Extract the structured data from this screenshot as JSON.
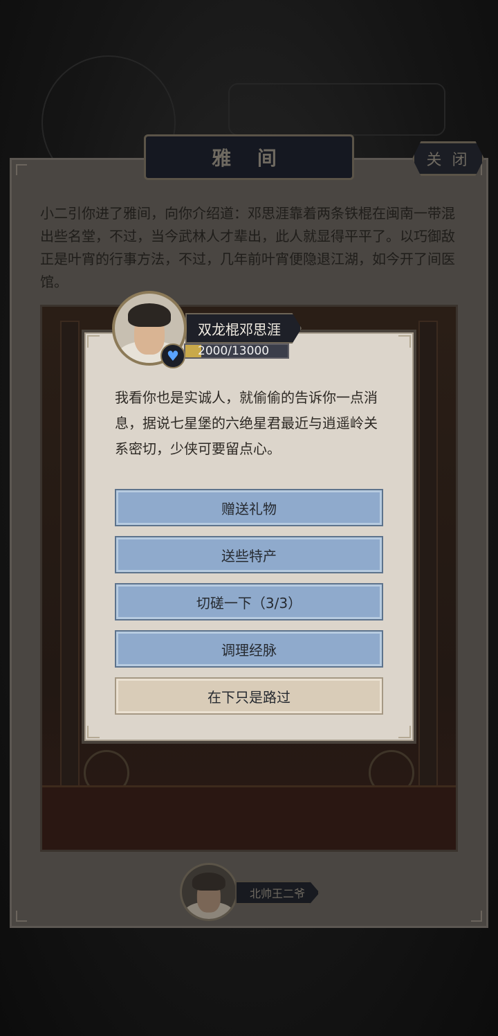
{
  "background": {
    "banner_text": "",
    "nav_items": []
  },
  "panel": {
    "title": "雅 间",
    "close_label": "关 闭",
    "intro": "小二引你进了雅间，向你介绍道：邓思涯靠着两条铁棍在闽南一带混出些名堂，不过，当今武林人才辈出，此人就显得平平了。以巧御敌正是叶宵的行事方法，不过，几年前叶宵便隐退江湖，如今开了间医馆。"
  },
  "npc": {
    "name": "双龙棍邓思涯",
    "affinity_text": "2000/13000",
    "affinity_fraction": 0.154,
    "heart_icon": "heart-icon"
  },
  "dialog": {
    "text": "我看你也是实诚人，就偷偷的告诉你一点消息，据说七星堡的六绝星君最近与逍遥岭关系密切，少侠可要留点心。"
  },
  "options": [
    {
      "label": "赠送礼物"
    },
    {
      "label": "送些特产"
    },
    {
      "label": "切磋一下（3/3）"
    },
    {
      "label": "调理经脉"
    },
    {
      "label": "在下只是路过"
    }
  ],
  "other_npc": {
    "name": "北帅王二爷"
  },
  "colors": {
    "option_blue": "#8faacc",
    "option_beige": "#d9ccb8",
    "heart": "#5aa3ff",
    "affinity_gold": "#c9a94a"
  }
}
